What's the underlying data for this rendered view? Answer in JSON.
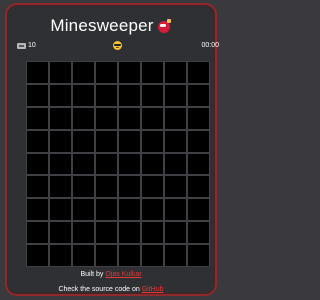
{
  "header": {
    "title": "Minesweeper",
    "title_icon": "bomb-icon"
  },
  "status": {
    "flag_icon": "flag-counter-icon",
    "flags_remaining": "10",
    "face_icon": "sunglasses-face-icon",
    "timer": "00:00"
  },
  "board": {
    "rows": 9,
    "columns": 8,
    "cell_state": "unrevealed"
  },
  "footer": {
    "built_by_prefix": "Built by",
    "author_link": "Ojas Kulkar",
    "source_prefix": "Check the source code on",
    "source_link": "GitHub"
  },
  "colors": {
    "frame_border": "#8e2a2c",
    "background": "#2e3034",
    "cell": "#000000",
    "link": "#e53935"
  }
}
